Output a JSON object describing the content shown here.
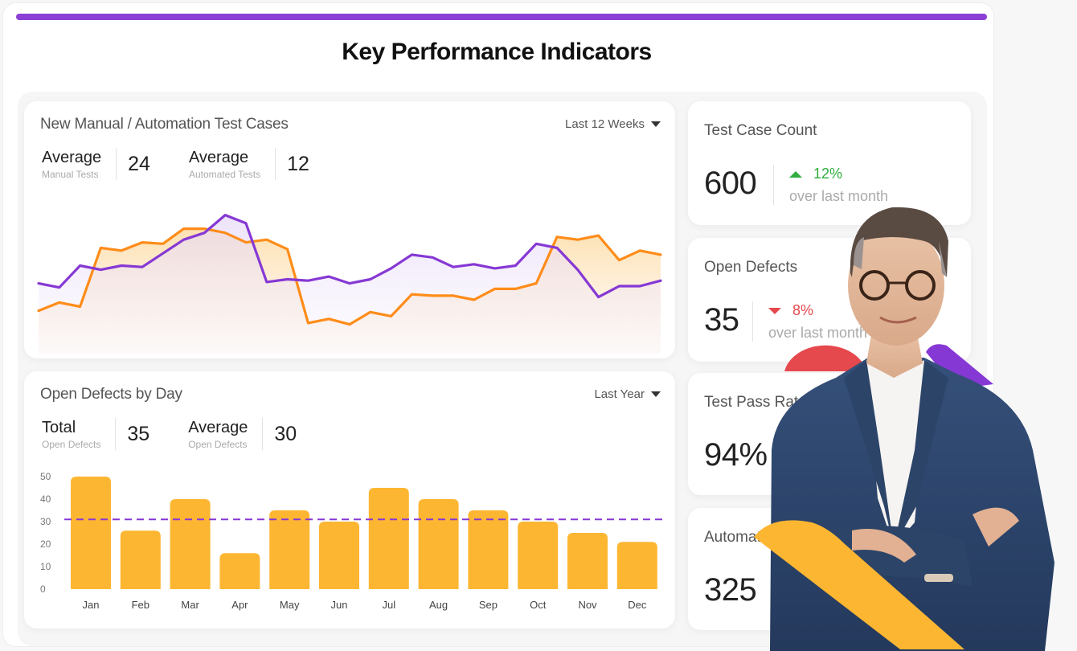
{
  "page": {
    "title": "Key Performance Indicators",
    "accent_color": "#8b3fd4"
  },
  "colors": {
    "manual": "#ff8c1a",
    "automated": "#8638d4",
    "bar": "#fdb632",
    "average_line": "#8638d4",
    "up": "#2fae3f",
    "down": "#e5484d"
  },
  "test_cases_card": {
    "title": "New Manual / Automation Test Cases",
    "range_label": "Last 12 Weeks",
    "stats": [
      {
        "label": "Average",
        "sublabel": "Manual Tests",
        "value": "24"
      },
      {
        "label": "Average",
        "sublabel": "Automated Tests",
        "value": "12"
      }
    ]
  },
  "defects_card": {
    "title": "Open Defects by Day",
    "range_label": "Last Year",
    "stats": [
      {
        "label": "Total",
        "sublabel": "Open Defects",
        "value": "35"
      },
      {
        "label": "Average",
        "sublabel": "Open Defects",
        "value": "30"
      }
    ]
  },
  "kpis": [
    {
      "title": "Test Case Count",
      "value": "600",
      "delta": "12%",
      "direction": "up",
      "sub": "over last month"
    },
    {
      "title": "Open Defects",
      "value": "35",
      "delta": "8%",
      "direction": "down",
      "sub": "over last month"
    },
    {
      "title": "Test Pass Rate",
      "value": "94%"
    },
    {
      "title": "Automated Tests",
      "value": "325"
    }
  ],
  "chart_data": [
    {
      "type": "area",
      "title": "New Manual / Automation Test Cases",
      "xlabel": "",
      "ylabel": "",
      "y_scale": "relative (unlabelled), 0-100",
      "ylim": [
        0,
        100
      ],
      "grid": false,
      "legend": "none",
      "x": [
        1,
        2,
        3,
        4,
        5,
        6,
        7,
        8,
        9,
        10,
        11,
        12,
        13,
        14,
        15,
        16,
        17,
        18,
        19,
        20,
        21,
        22,
        23,
        24,
        25,
        26,
        27,
        28,
        29,
        30,
        31
      ],
      "series": [
        {
          "name": "Manual Tests",
          "color": "#ff8c1a",
          "values": [
            22,
            28,
            25,
            68,
            66,
            72,
            71,
            82,
            82,
            79,
            72,
            74,
            67,
            13,
            16,
            12,
            21,
            18,
            34,
            33,
            33,
            30,
            38,
            38,
            42,
            76,
            74,
            77,
            59,
            66,
            63
          ]
        },
        {
          "name": "Automated Tests",
          "color": "#8638d4",
          "values": [
            42,
            39,
            55,
            52,
            55,
            54,
            64,
            74,
            79,
            92,
            86,
            43,
            45,
            44,
            47,
            42,
            45,
            53,
            63,
            61,
            54,
            56,
            53,
            55,
            71,
            68,
            52,
            32,
            40,
            40,
            44
          ]
        }
      ]
    },
    {
      "type": "bar",
      "title": "Open Defects by Day",
      "xlabel": "",
      "ylabel": "",
      "categories": [
        "Jan",
        "Feb",
        "Mar",
        "Apr",
        "May",
        "Jun",
        "Jul",
        "Aug",
        "Sep",
        "Oct",
        "Nov",
        "Dec"
      ],
      "values": [
        50,
        26,
        40,
        16,
        35,
        30,
        45,
        40,
        35,
        30,
        25,
        21
      ],
      "average_line": 31,
      "yticks": [
        0,
        10,
        20,
        30,
        40,
        50
      ],
      "ylim": [
        0,
        50
      ],
      "grid": false,
      "legend": "none"
    }
  ]
}
